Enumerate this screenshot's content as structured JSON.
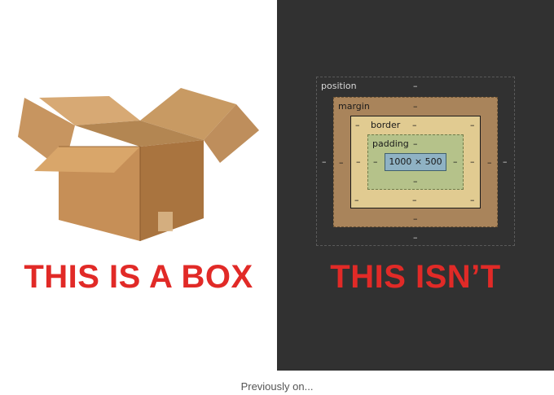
{
  "left": {
    "caption": "THIS IS A BOX"
  },
  "right": {
    "caption": "THIS ISN’T",
    "box_model": {
      "position_label": "position",
      "margin_label": "margin",
      "border_label": "border",
      "padding_label": "padding",
      "content_size": "1000 × 500",
      "dash": "–"
    }
  },
  "footer": {
    "caption": "Previously on..."
  },
  "colors": {
    "caption_red": "#e12a27",
    "dark_panel": "#313131",
    "margin": "#a9845b",
    "border": "#e1cb91",
    "padding": "#b5c28a",
    "content": "#8fb2c4"
  }
}
